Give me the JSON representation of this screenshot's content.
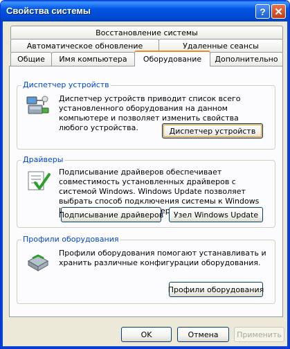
{
  "window": {
    "title": "Свойства системы",
    "help_glyph": "?",
    "close_glyph": "✕"
  },
  "tabs": {
    "row1": [
      "Восстановление системы"
    ],
    "row2": [
      "Автоматическое обновление",
      "Удаленные сеансы"
    ],
    "row3": [
      "Общие",
      "Имя компьютера",
      "Оборудование",
      "Дополнительно"
    ],
    "active": "Оборудование"
  },
  "device_manager": {
    "title": "Диспетчер устройств",
    "description": "Диспетчер устройств приводит список всего установленного оборудования на данном компьютере и позволяет изменить свойства любого устройства.",
    "button": "Диспетчер устройств",
    "icon": "device-manager-icon"
  },
  "drivers": {
    "title": "Драйверы",
    "description": "Подписывание драйверов обеспечивает совместимость установленных драйверов с системой Windows.  Windows Update позволяет выбрать способ подключения системы к Windows Update для поиска драйверов.",
    "button_signing": "Подписывание драйверов",
    "button_update": "Узел Windows Update",
    "icon": "drivers-checkmark-icon"
  },
  "hardware_profiles": {
    "title": "Профили оборудования",
    "description": "Профили оборудования помогают устанавливать и хранить различные конфигурации оборудования.",
    "button": "Профили оборудования",
    "icon": "hardware-profiles-icon"
  },
  "footer": {
    "ok": "OK",
    "cancel": "Отмена",
    "apply": "Применить"
  },
  "colors": {
    "title_bar": "#0054e3",
    "dialog_bg": "#ece9d8",
    "group_title": "#0046d5",
    "active_tab_accent": "#e68b2c"
  }
}
